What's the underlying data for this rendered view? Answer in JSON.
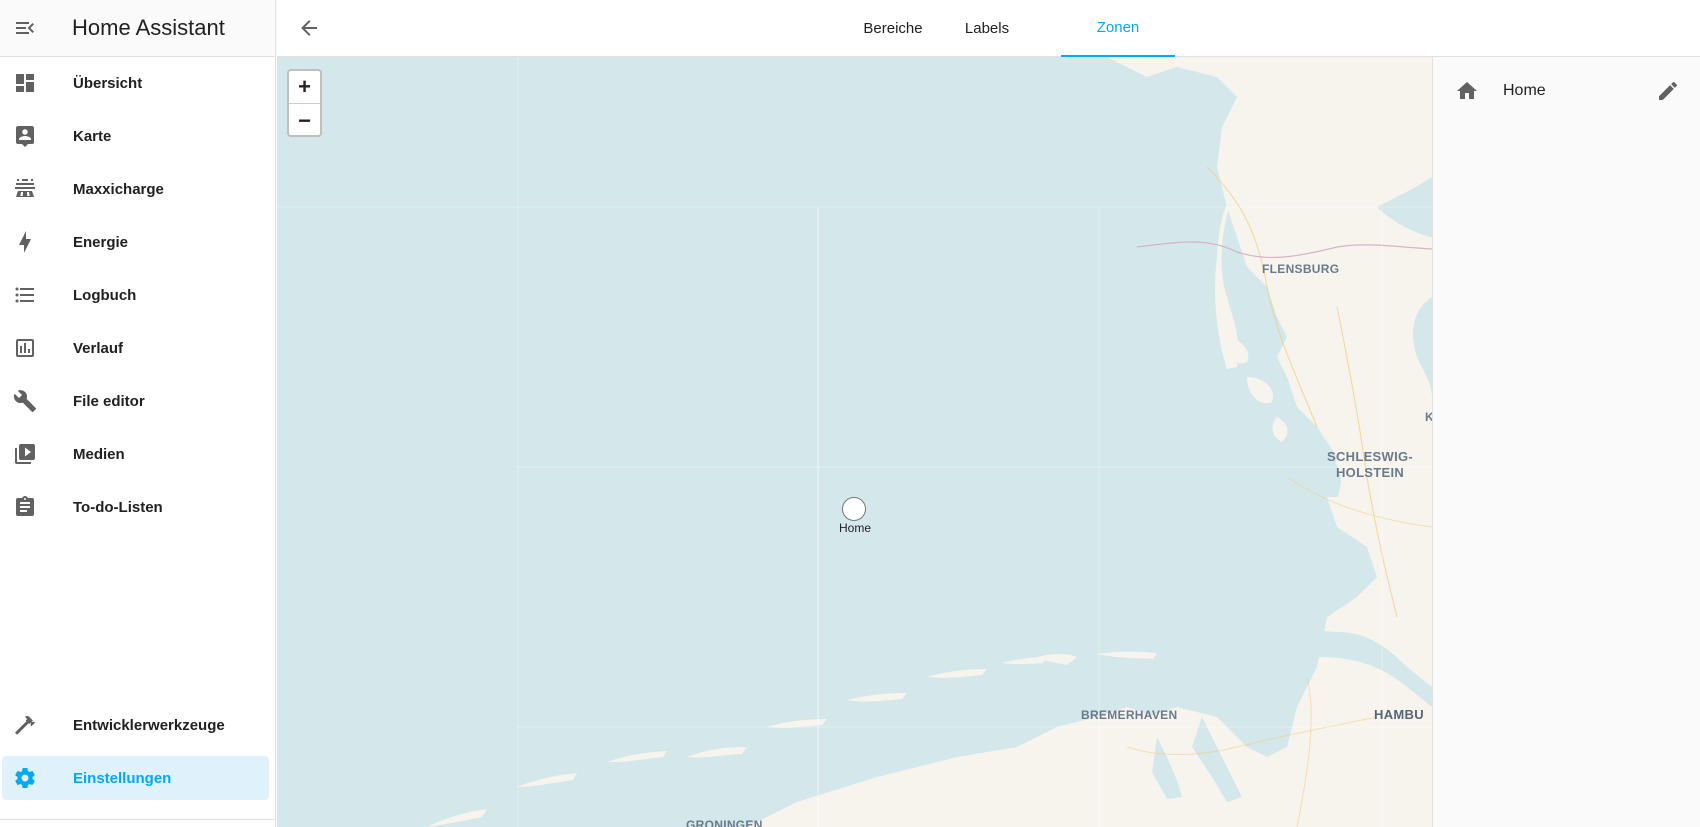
{
  "app": {
    "title": "Home Assistant"
  },
  "sidebar": {
    "items": [
      {
        "label": "Übersicht",
        "icon": "dashboard-icon"
      },
      {
        "label": "Karte",
        "icon": "account-box-icon"
      },
      {
        "label": "Maxxicharge",
        "icon": "solar-panel-icon"
      },
      {
        "label": "Energie",
        "icon": "lightning-bolt-icon"
      },
      {
        "label": "Logbuch",
        "icon": "format-list-icon"
      },
      {
        "label": "Verlauf",
        "icon": "chart-box-icon"
      },
      {
        "label": "File editor",
        "icon": "wrench-icon"
      },
      {
        "label": "Medien",
        "icon": "play-box-multiple-icon"
      },
      {
        "label": "To-do-Listen",
        "icon": "clipboard-list-icon"
      }
    ],
    "bottom_items": [
      {
        "label": "Entwicklerwerkzeuge",
        "icon": "hammer-icon"
      },
      {
        "label": "Einstellungen",
        "icon": "cog-icon",
        "active": true
      }
    ]
  },
  "tabs": [
    {
      "label": "Bereiche"
    },
    {
      "label": "Labels"
    },
    {
      "label": "Zonen",
      "active": true
    }
  ],
  "map": {
    "zoom_in": "+",
    "zoom_out": "−",
    "zone_marker_label": "Home",
    "place_labels": [
      "FLENSBURG",
      "SCHLESWIG-\nHOLSTEIN",
      "BREMERHAVEN",
      "HAMBU",
      "GRONINGEN",
      "K"
    ]
  },
  "zones": [
    {
      "name": "Home",
      "icon": "home-icon"
    }
  ],
  "colors": {
    "accent": "#03a9f4",
    "water": "#d4e7ea",
    "land": "#f7f4ee"
  }
}
